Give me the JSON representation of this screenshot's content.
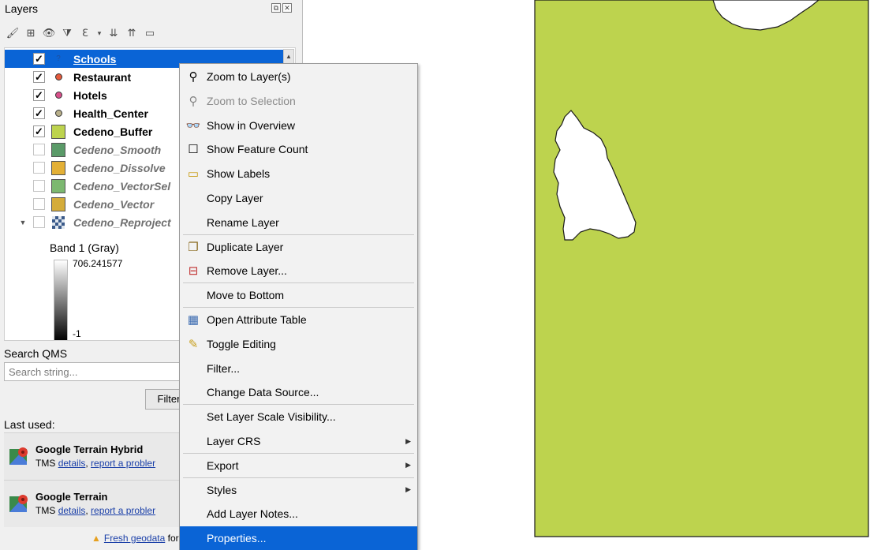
{
  "layers_panel": {
    "title": "Layers",
    "dock_float": "⧉",
    "dock_close": "✕",
    "layers": [
      {
        "name": "Schools",
        "checked": true,
        "symbol": "question",
        "selected": true,
        "active": true
      },
      {
        "name": "Restaurant",
        "checked": true,
        "symbol": "dot",
        "color": "#e65a3c",
        "active": true
      },
      {
        "name": "Hotels",
        "checked": true,
        "symbol": "dot",
        "color": "#d8508a",
        "active": true
      },
      {
        "name": "Health_Center",
        "checked": true,
        "symbol": "dot",
        "color": "#b9b08a",
        "active": true
      },
      {
        "name": "Cedeno_Buffer",
        "checked": true,
        "symbol": "poly",
        "color": "#bdd34e",
        "active": true
      },
      {
        "name": "Cedeno_Smooth",
        "checked": false,
        "symbol": "poly",
        "color": "#5a9a68",
        "active": false
      },
      {
        "name": "Cedeno_Dissolve",
        "checked": false,
        "symbol": "poly",
        "color": "#e3b036",
        "active": false
      },
      {
        "name": "Cedeno_VectorSel",
        "checked": false,
        "symbol": "poly",
        "color": "#7cb870",
        "active": false
      },
      {
        "name": "Cedeno_Vector",
        "checked": false,
        "symbol": "poly",
        "color": "#d4ac3a",
        "active": false
      },
      {
        "name": "Cedeno_Reproject",
        "checked": false,
        "symbol": "raster",
        "active": false,
        "expanded": true
      }
    ],
    "raster_band": {
      "label": "Band 1 (Gray)",
      "max": "706.241577",
      "min": "-1"
    }
  },
  "qms": {
    "title": "Search QMS",
    "search_placeholder": "Search string...",
    "filter_label": "Filter",
    "last_used_label": "Last used:",
    "items": [
      {
        "name": "Google Terrain Hybrid",
        "type": "TMS",
        "details": "details",
        "sep": ", ",
        "report": "report a probler"
      },
      {
        "name": "Google Terrain",
        "type": "TMS",
        "details": "details",
        "sep": ", ",
        "report": "report a probler"
      }
    ],
    "geodata_link": "Fresh geodata",
    "geodata_suffix": " for y"
  },
  "context_menu": {
    "items": [
      {
        "label": "Zoom to Layer(s)",
        "icon": "zoom-layer-icon",
        "disabled": false
      },
      {
        "label": "Zoom to Selection",
        "icon": "zoom-selection-icon",
        "disabled": true
      },
      {
        "label": "Show in Overview",
        "icon": "overview-glasses-icon",
        "disabled": false
      },
      {
        "label": "Show Feature Count",
        "icon": "checkbox-icon",
        "disabled": false
      },
      {
        "label": "Show Labels",
        "icon": "labels-abc-icon",
        "disabled": false
      },
      {
        "label": "Copy Layer",
        "icon": "",
        "disabled": false
      },
      {
        "label": "Rename Layer",
        "icon": "",
        "disabled": false,
        "sep_after": true
      },
      {
        "label": "Duplicate Layer",
        "icon": "duplicate-layer-icon",
        "disabled": false
      },
      {
        "label": "Remove Layer...",
        "icon": "remove-layer-icon",
        "disabled": false,
        "sep_after": true
      },
      {
        "label": "Move to Bottom",
        "icon": "",
        "disabled": false,
        "sep_after": true
      },
      {
        "label": "Open Attribute Table",
        "icon": "attribute-table-icon",
        "disabled": false
      },
      {
        "label": "Toggle Editing",
        "icon": "pencil-icon",
        "disabled": false
      },
      {
        "label": "Filter...",
        "icon": "",
        "disabled": false
      },
      {
        "label": "Change Data Source...",
        "icon": "",
        "disabled": false,
        "sep_after": true
      },
      {
        "label": "Set Layer Scale Visibility...",
        "icon": "",
        "disabled": false
      },
      {
        "label": "Layer CRS",
        "icon": "",
        "disabled": false,
        "submenu": true,
        "sep_after": true
      },
      {
        "label": "Export",
        "icon": "",
        "disabled": false,
        "submenu": true,
        "sep_after": true
      },
      {
        "label": "Styles",
        "icon": "",
        "disabled": false,
        "submenu": true
      },
      {
        "label": "Add Layer Notes...",
        "icon": "",
        "disabled": false
      },
      {
        "label": "Properties...",
        "icon": "",
        "disabled": false,
        "highlighted": true
      }
    ]
  },
  "map": {
    "polygon_fill": "#bdd34e",
    "outline": "#1a1a1a",
    "hole_fill": "#ffffff"
  }
}
